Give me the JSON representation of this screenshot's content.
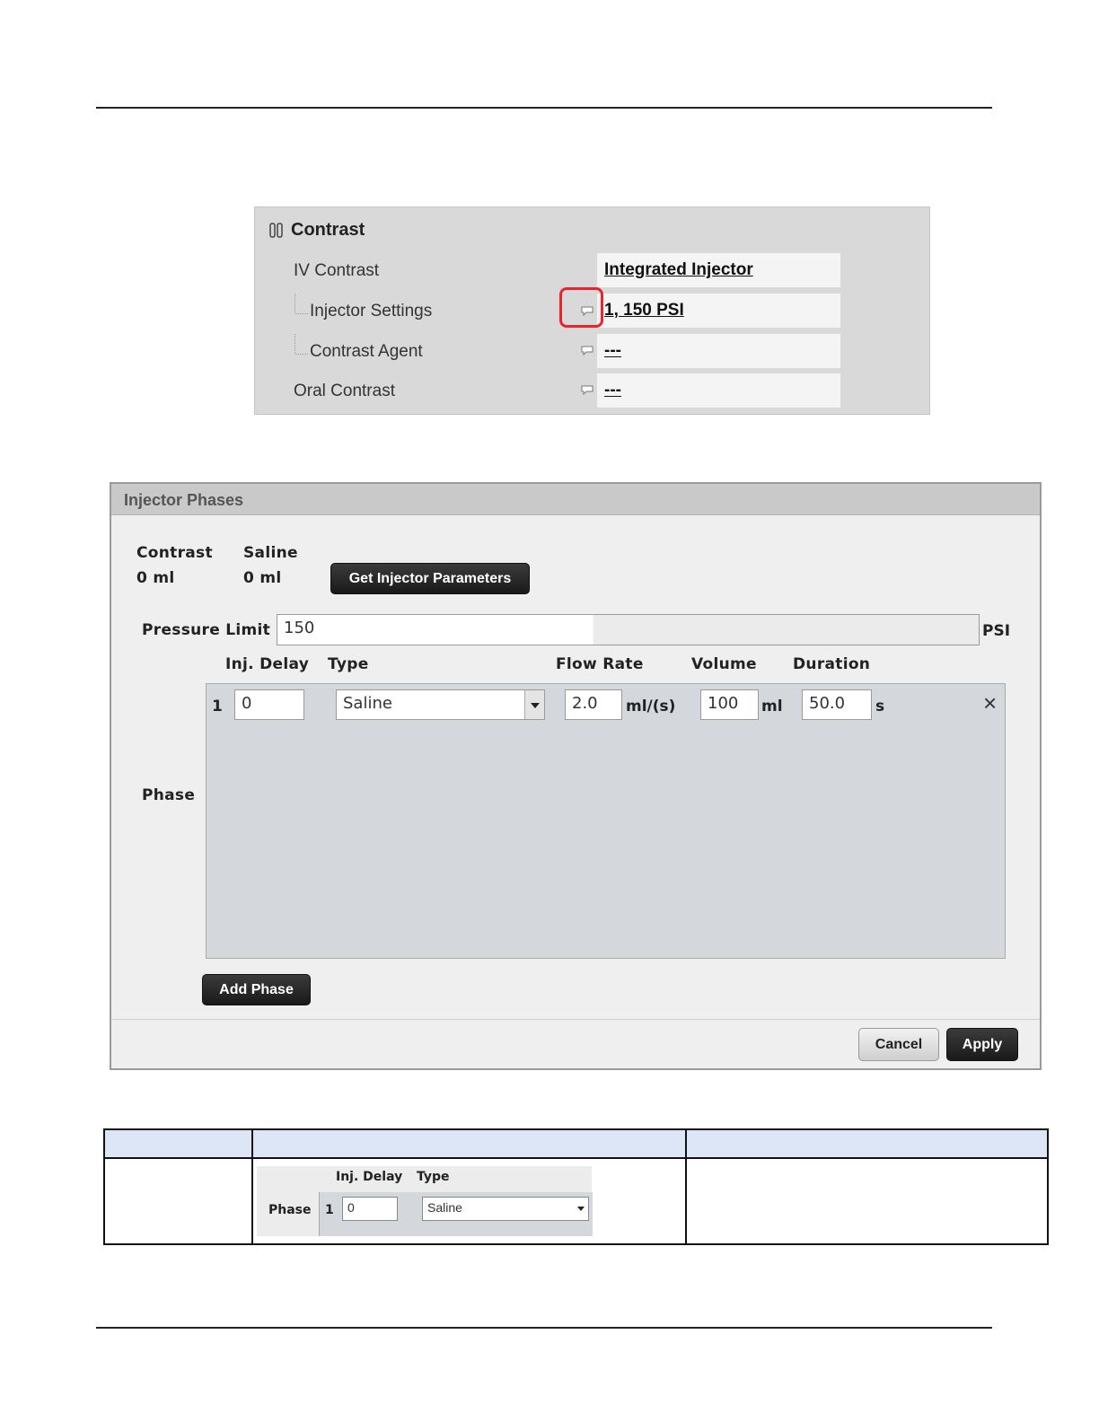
{
  "contrast_panel": {
    "title": "Contrast",
    "rows": [
      {
        "label": "IV Contrast",
        "value": "Integrated Injector"
      },
      {
        "label": "Injector Settings",
        "value": "1, 150 PSI"
      },
      {
        "label": "Contrast Agent",
        "value": "---"
      },
      {
        "label": "Oral Contrast",
        "value": "---"
      }
    ]
  },
  "dialog": {
    "title": "Injector Phases",
    "contrast_label": "Contrast",
    "contrast_value": "0 ml",
    "saline_label": "Saline",
    "saline_value": "0 ml",
    "get_params_button": "Get Injector Parameters",
    "pressure_limit_label": "Pressure Limit",
    "pressure_limit_value": "150",
    "pressure_unit": "PSI",
    "columns": {
      "inj_delay": "Inj. Delay",
      "type": "Type",
      "flow_rate": "Flow Rate",
      "volume": "Volume",
      "duration": "Duration"
    },
    "phase_label": "Phase",
    "phases": [
      {
        "index": "1",
        "inj_delay": "0",
        "type": "Saline",
        "flow_rate": "2.0",
        "flow_unit": "ml/(s)",
        "volume": "100",
        "volume_unit": "ml",
        "duration": "50.0",
        "duration_unit": "s",
        "remove": "×"
      }
    ],
    "add_phase_button": "Add Phase",
    "cancel_button": "Cancel",
    "apply_button": "Apply"
  },
  "table_example": {
    "inj_delay": "Inj. Delay",
    "type": "Type",
    "phase": "Phase",
    "index": "1",
    "delay_value": "0",
    "type_value": "Saline"
  }
}
